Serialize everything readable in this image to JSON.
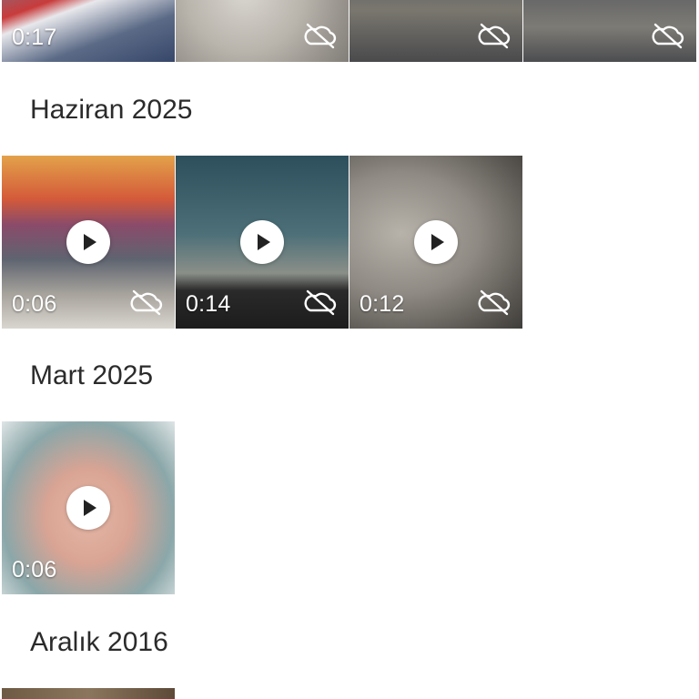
{
  "colors": {
    "background": "#ffffff",
    "heading_text": "#2b2b2b",
    "overlay_text": "#ffffff"
  },
  "top_row": {
    "items": [
      {
        "duration": "0:17",
        "thumb": "baby-in-striped-outfit",
        "cloud_icon": "cloud-off-icon"
      },
      {
        "duration": "",
        "thumb": "cave-with-people",
        "cloud_icon": "cloud-off-icon"
      },
      {
        "duration": "",
        "thumb": "railway-market",
        "cloud_icon": "cloud-off-icon"
      },
      {
        "duration": "",
        "thumb": "railway-tracks",
        "cloud_icon": "cloud-off-icon"
      }
    ]
  },
  "sections": [
    {
      "title": "Haziran 2025",
      "items": [
        {
          "duration": "0:06",
          "thumb": "hot-air-balloons",
          "play_icon": "play-icon",
          "cloud_icon": "cloud-off-icon"
        },
        {
          "duration": "0:14",
          "thumb": "balloon-at-dusk",
          "play_icon": "play-icon",
          "cloud_icon": "cloud-off-icon"
        },
        {
          "duration": "0:12",
          "thumb": "cave-rock",
          "play_icon": "play-icon",
          "cloud_icon": "cloud-off-icon"
        }
      ]
    },
    {
      "title": "Mart 2025",
      "items": [
        {
          "duration": "0:06",
          "thumb": "blurred-face",
          "play_icon": "play-icon"
        }
      ]
    },
    {
      "title": "Aralık 2016",
      "items": []
    }
  ]
}
